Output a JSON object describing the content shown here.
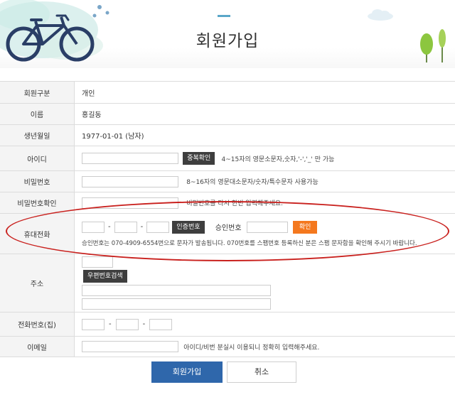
{
  "header": {
    "title": "회원가입"
  },
  "form": {
    "member_type": {
      "label": "회원구분",
      "value": "개인"
    },
    "name": {
      "label": "이름",
      "value": "홍길동"
    },
    "birth": {
      "label": "생년월일",
      "value": "1977-01-01 (남자)"
    },
    "user_id": {
      "label": "아이디",
      "button": "중복확인",
      "hint": "4~15자의 영문소문자,숫자,'-','_' 만 가능"
    },
    "password": {
      "label": "비밀번호",
      "hint": "8~16자의 영문대소문자/숫자/특수문자 사용가능"
    },
    "password_confirm": {
      "label": "비밀번호확인",
      "hint": "비밀번호를 다시 한번 입력해주세요."
    },
    "mobile": {
      "label": "휴대전화",
      "sep1": "-",
      "sep2": "-",
      "auth_button": "인증번호",
      "approval_label": "승인번호",
      "confirm_button": "확인",
      "note": "승인번호는 070-4909-6554번으로 문자가 발송됩니다. 070번호를 스팸번호 등록하신 분은 스팸 문자함을 확인해 주시기 바랍니다."
    },
    "address": {
      "label": "주소",
      "zip_button": "우편번호검색"
    },
    "home_phone": {
      "label": "전화번호(집)",
      "sep1": "-",
      "sep2": "-"
    },
    "email": {
      "label": "이메일",
      "hint": "아이디/비번 분실시 이용되니 정확히 입력해주세요."
    }
  },
  "actions": {
    "submit": "회원가입",
    "cancel": "취소"
  },
  "colors": {
    "accent_blue": "#2f67ab",
    "orange": "#f4781e",
    "highlight_red": "#c9211e",
    "dark_button": "#3e3e3e"
  }
}
